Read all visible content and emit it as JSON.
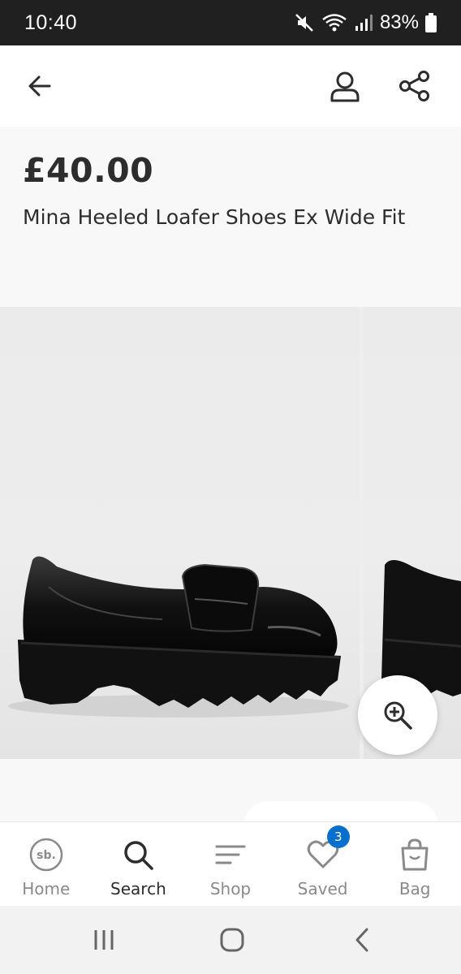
{
  "status_bar": {
    "time": "10:40",
    "battery": "83%",
    "icons": [
      "mute-icon",
      "wifi-icon",
      "signal-icon",
      "battery-icon"
    ]
  },
  "header": {
    "icons": [
      "back-arrow-icon",
      "account-icon",
      "share-icon"
    ]
  },
  "product": {
    "price": "£40.00",
    "name": "Mina Heeled Loafer Shoes Ex Wide Fit"
  },
  "gallery": {
    "zoom_icon": "zoom-in-icon"
  },
  "bottom_nav": {
    "items": [
      {
        "label": "Home",
        "icon": "home-logo-icon",
        "active": false
      },
      {
        "label": "Search",
        "icon": "search-icon",
        "active": true
      },
      {
        "label": "Shop",
        "icon": "menu-lines-icon",
        "active": false
      },
      {
        "label": "Saved",
        "icon": "heart-icon",
        "active": false,
        "badge": "3"
      },
      {
        "label": "Bag",
        "icon": "bag-icon",
        "active": false
      }
    ]
  },
  "colors": {
    "badge": "#0770cf",
    "text": "#2d2d2d",
    "inactive": "#8a8a8a"
  }
}
